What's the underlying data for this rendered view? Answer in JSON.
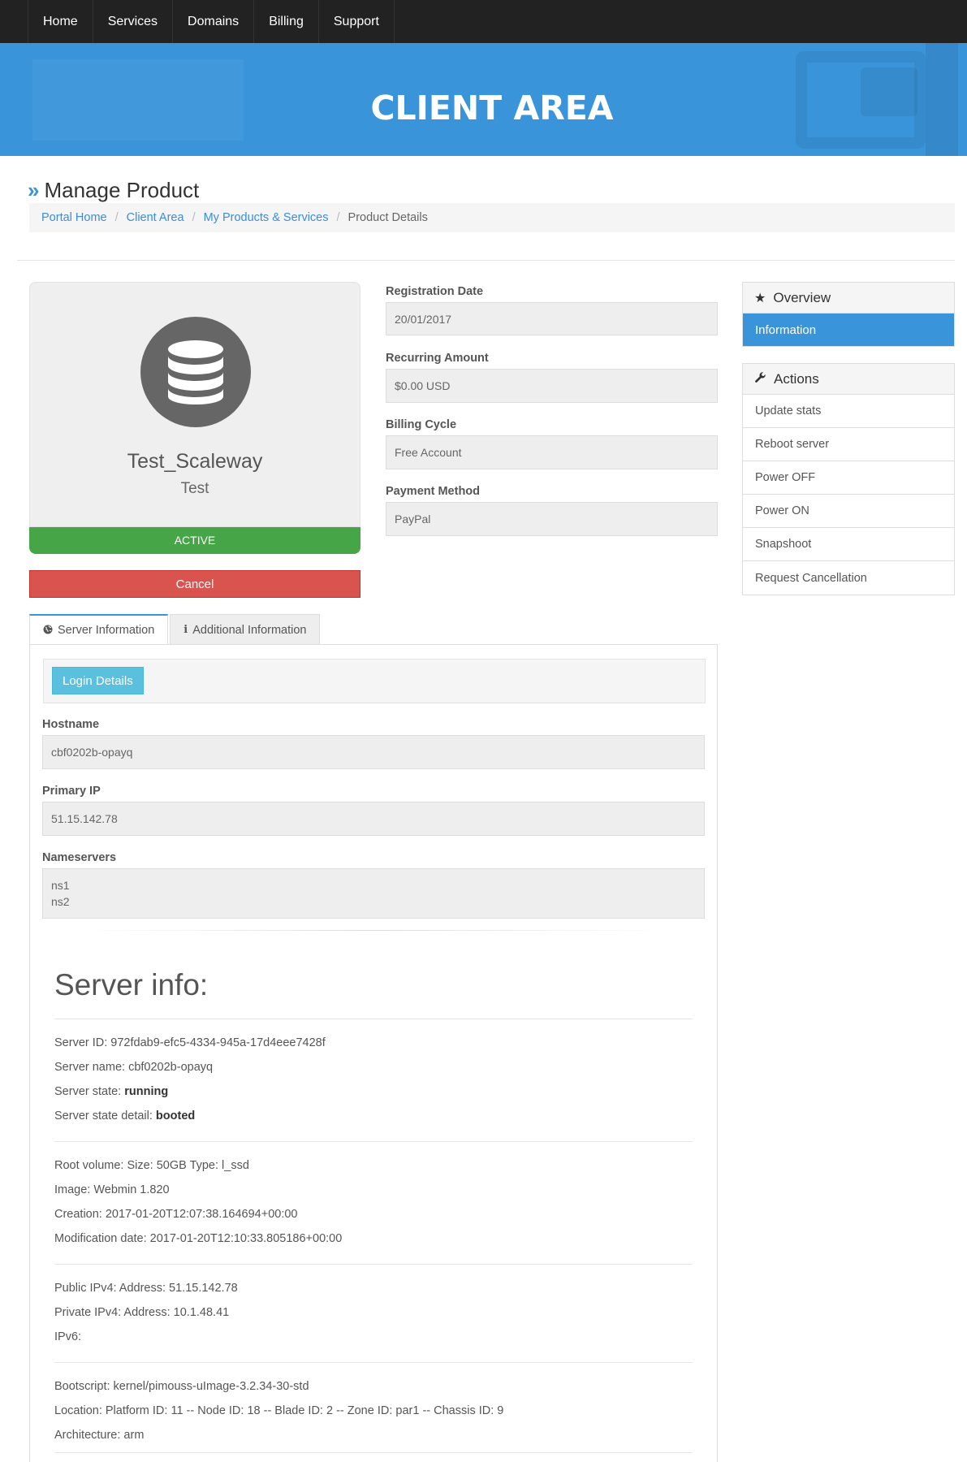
{
  "nav": {
    "items": [
      {
        "label": "Home"
      },
      {
        "label": "Services"
      },
      {
        "label": "Domains"
      },
      {
        "label": "Billing"
      },
      {
        "label": "Support"
      }
    ]
  },
  "hero": {
    "title": "CLIENT AREA"
  },
  "header": {
    "chevron": "»",
    "title": "Manage Product",
    "breadcrumb": [
      "Portal Home",
      "Client Area",
      "My Products & Services",
      "Product Details"
    ],
    "separator": "/"
  },
  "product": {
    "icon": "database-icon",
    "name": "Test_Scaleway",
    "group": "Test",
    "status": "ACTIVE",
    "cancel_label": "Cancel"
  },
  "details": [
    {
      "label": "Registration Date",
      "value": "20/01/2017"
    },
    {
      "label": "Recurring Amount",
      "value": "$0.00 USD"
    },
    {
      "label": "Billing Cycle",
      "value": "Free Account"
    },
    {
      "label": "Payment Method",
      "value": "PayPal"
    }
  ],
  "sidebar": {
    "overview": {
      "title": "Overview",
      "icon": "star-icon",
      "items": [
        {
          "label": "Information"
        }
      ]
    },
    "actions": {
      "title": "Actions",
      "icon": "wrench-icon",
      "items": [
        {
          "label": "Update stats"
        },
        {
          "label": "Reboot server"
        },
        {
          "label": "Power OFF"
        },
        {
          "label": "Power ON"
        },
        {
          "label": "Snapshoot"
        },
        {
          "label": "Request Cancellation"
        }
      ]
    }
  },
  "tabs": [
    {
      "label": "Server Information",
      "icon": "globe-icon"
    },
    {
      "label": "Additional Information",
      "icon": "info-icon"
    }
  ],
  "server_tab": {
    "login_label": "Login Details",
    "hostname_label": "Hostname",
    "hostname": "cbf0202b-opayq",
    "ip_label": "Primary IP",
    "ip": "51.15.142.78",
    "ns_label": "Nameservers",
    "ns1": "ns1",
    "ns2": "ns2"
  },
  "server_info": {
    "title": "Server info:",
    "id_label": "Server ID: ",
    "id": "972fdab9-efc5-4334-945a-17d4eee7428f",
    "name_label": "Server name: ",
    "name": "cbf0202b-opayq",
    "state_label": "Server state: ",
    "state": "running",
    "state_detail_label": "Server state detail: ",
    "state_detail": "booted",
    "root_volume": "Root volume: Size: 50GB Type: l_ssd",
    "image": "Image: Webmin 1.820",
    "creation": "Creation: 2017-01-20T12:07:38.164694+00:00",
    "modification": "Modification date: 2017-01-20T12:10:33.805186+00:00",
    "public_ipv4": "Public IPv4: Address: 51.15.142.78",
    "private_ipv4": "Private IPv4: Address: 10.1.48.41",
    "ipv6": "IPv6:",
    "bootscript": "Bootscript: kernel/pimouss-uImage-3.2.34-30-std",
    "location": "Location: Platform ID: 11 -- Node ID: 18 -- Blade ID: 2 -- Zone ID: par1 -- Chassis ID: 9",
    "architecture": "Architecture: arm"
  },
  "colors": {
    "accent": "#3a94da",
    "navbar": "#222222",
    "active": "#46a546",
    "danger": "#d9534f",
    "info": "#5bc0de"
  }
}
